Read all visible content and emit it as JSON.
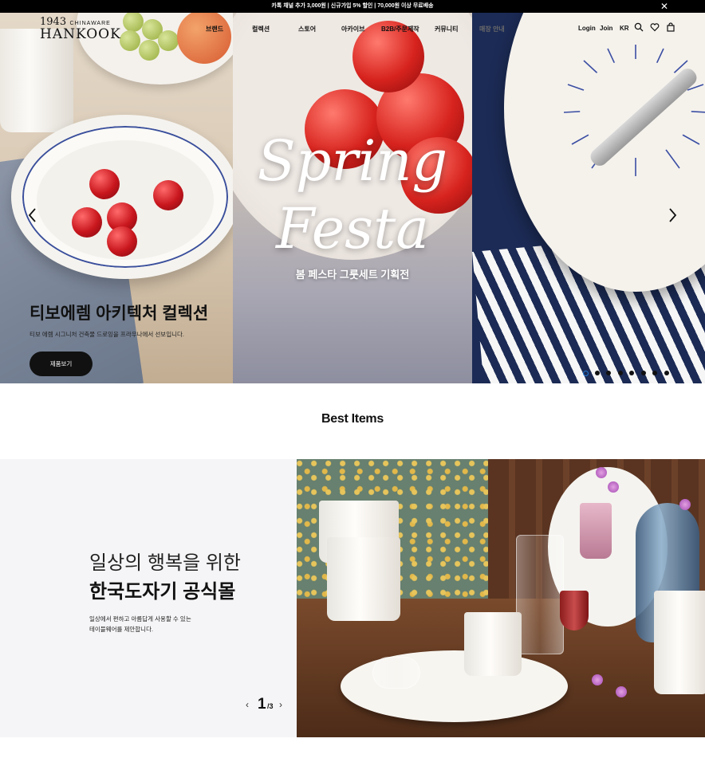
{
  "notice": {
    "text": "카톡 채널 추가 3,000원 | 신규가입 5% 할인 | 70,000원 이상 무료배송",
    "close_icon": "close-icon"
  },
  "header": {
    "logo_year": "1943",
    "logo_chinaware": "CHINAWARE",
    "logo_name": "HANKOOK",
    "nav": [
      "브랜드",
      "컬렉션",
      "스토어",
      "아카이브",
      "B2B/주문제작",
      "커뮤니티",
      "매장 안내"
    ],
    "login": "Login",
    "join": "Join",
    "lang": "KR",
    "icons": [
      "search-icon",
      "heart-icon",
      "bag-icon"
    ]
  },
  "hero": {
    "spring_line1": "Spring",
    "spring_line2": "Festa",
    "spring_sub": "봄 페스타 그룻세트 기획전",
    "title": "티보에렘 아키텍처 컬렉션",
    "desc": "티보 에렘 시그니처 건축물 드로잉을 프라우나에서 선보입니다.",
    "button": "제품보기",
    "slide_count": 8,
    "active_slide": 0
  },
  "best": {
    "title": "Best Items"
  },
  "section2": {
    "line1": "일상의 행복을 위한",
    "line2": "한국도자기 공식몰",
    "desc_line1": "일상에서 편하고 아름답게 사용할 수 있는",
    "desc_line2": "테이블웨어를 제안합니다.",
    "page_current": "1",
    "page_total": "/3"
  },
  "colors": {
    "accent_dot": "#1f79d4",
    "notice_bg": "#000000",
    "section_bg": "#f5f5f7"
  }
}
